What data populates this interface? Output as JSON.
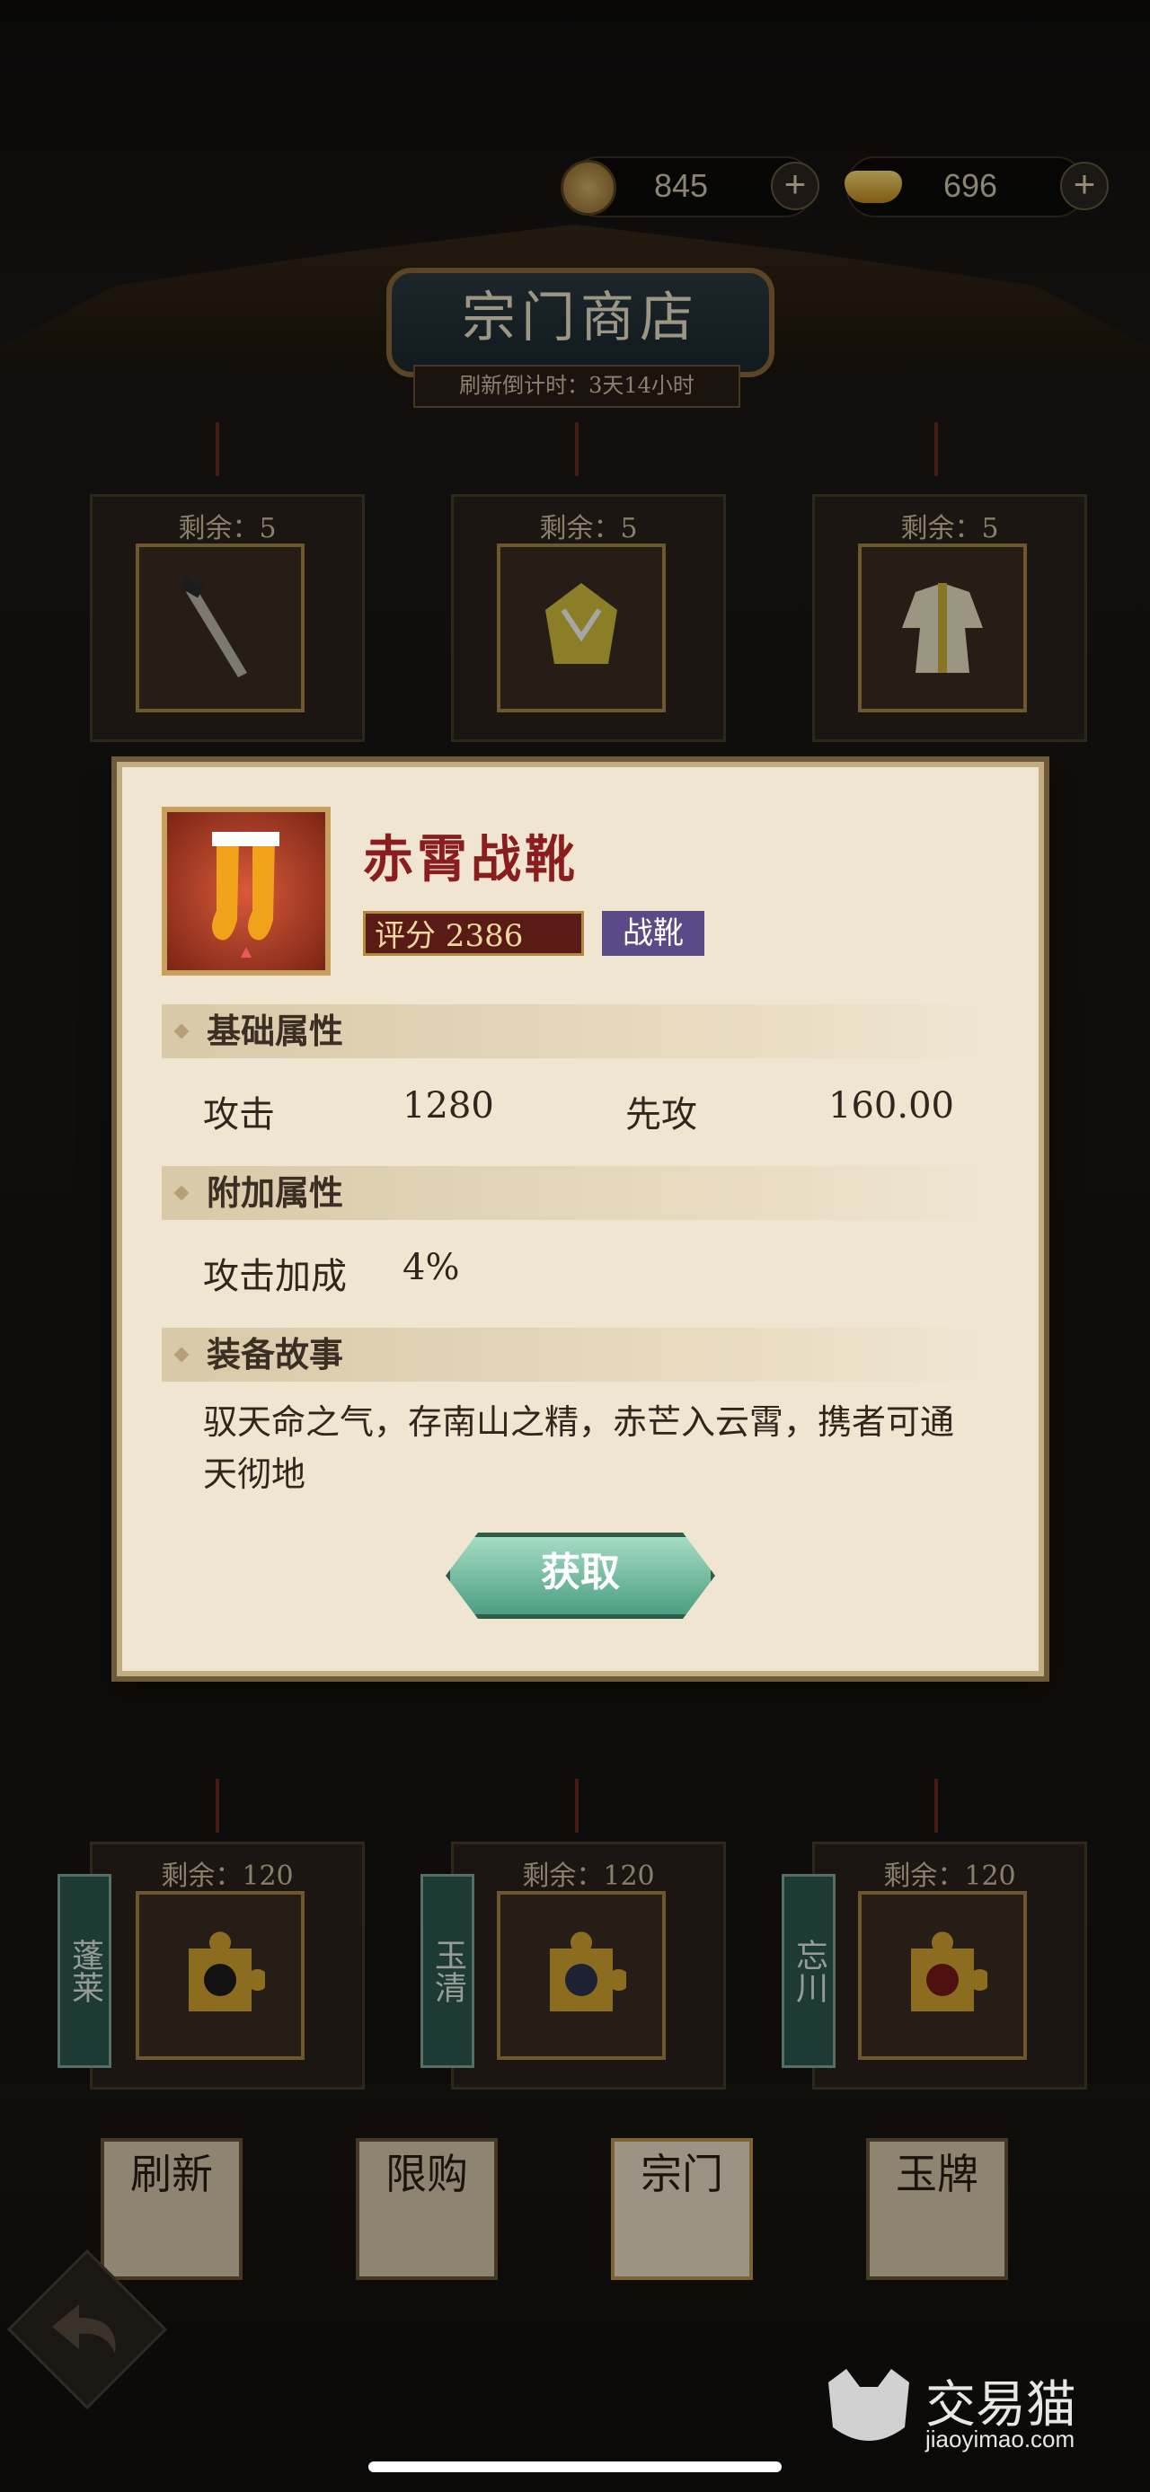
{
  "currency": {
    "coin_value": "845",
    "coin_icon": "copper-coin-icon",
    "ingot_value": "696",
    "ingot_icon": "gold-ingot-icon",
    "plus_symbol": "+"
  },
  "shop": {
    "title": "宗门商店",
    "refresh_countdown": "刷新倒计时：3天14小时"
  },
  "top_items": [
    {
      "remain": "剩余：5",
      "icon": "dagger-icon"
    },
    {
      "remain": "剩余：5",
      "icon": "armor-icon"
    },
    {
      "remain": "剩余：5",
      "icon": "robe-icon"
    }
  ],
  "bottom_items": [
    {
      "remain": "剩余：120",
      "side": "蓬莱",
      "icon": "puzzle-piece-icon"
    },
    {
      "remain": "剩余：120",
      "side": "玉清",
      "icon": "puzzle-piece-icon"
    },
    {
      "remain": "剩余：120",
      "side": "忘川",
      "icon": "puzzle-piece-icon"
    }
  ],
  "dialog": {
    "item_name": "赤霄战靴",
    "score_label": "评分 2386",
    "type_tag": "战靴",
    "base_section": "基础属性",
    "base_stats": [
      {
        "label": "攻击",
        "value": "1280"
      },
      {
        "label": "先攻",
        "value": "160.00"
      }
    ],
    "extra_section": "附加属性",
    "extra_stats": [
      {
        "label": "攻击加成",
        "value": "4%"
      }
    ],
    "story_section": "装备故事",
    "story_text": "驭天命之气，存南山之精，赤芒入云霄，携者可通天彻地",
    "obtain_button": "获取"
  },
  "tabs": [
    {
      "label": "刷新"
    },
    {
      "label": "限购"
    },
    {
      "label": "宗门"
    },
    {
      "label": "玉牌"
    }
  ],
  "watermark": {
    "cn": "交易猫",
    "url": "jiaoyimao.com"
  }
}
